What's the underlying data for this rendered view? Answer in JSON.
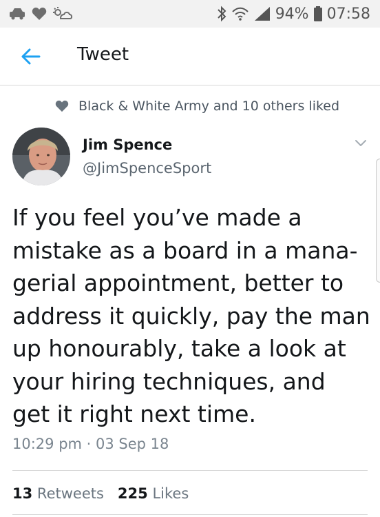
{
  "status_bar": {
    "battery": "94%",
    "time": "07:58"
  },
  "app_bar": {
    "title": "Tweet",
    "back_icon": "arrow-left-icon"
  },
  "tweet": {
    "liked_by": "Black & White Army and 10 others liked",
    "author_name": "Jim Spence",
    "author_handle": "@JimSpenceSport",
    "lines": [
      "If you feel you’ve made a",
      "mistake as a board in a mana-",
      "gerial appointment, better to",
      "address it quickly, pay the man",
      "up honourably, take a look at",
      "your hiring techniques, and",
      "get it right next time."
    ],
    "timestamp": "10:29 pm · 03 Sep 18",
    "retweets_count": "13",
    "retweets_label": "Retweets",
    "likes_count": "225",
    "likes_label": "Likes"
  },
  "colors": {
    "accent": "#1da1f2",
    "text_primary": "#14171a",
    "text_secondary": "#5b6670"
  }
}
